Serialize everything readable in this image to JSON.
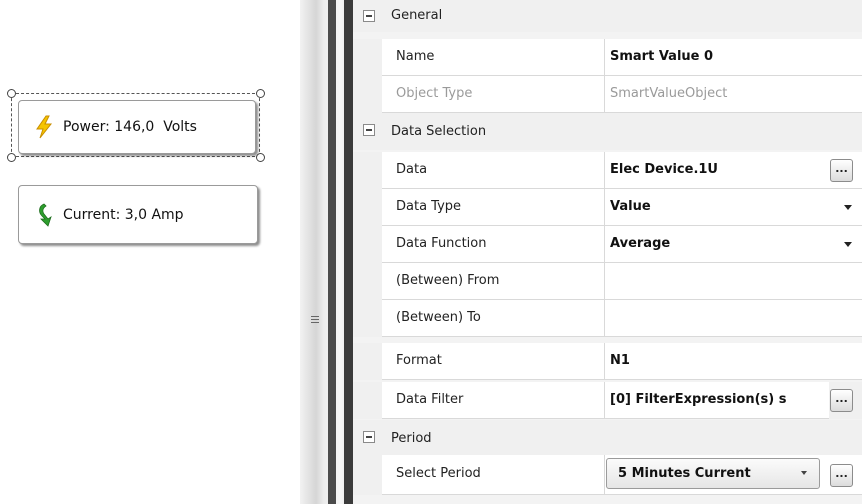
{
  "canvas": {
    "widgets": [
      {
        "label": "Power: 146,0  Volts",
        "icon": "lightning-icon"
      },
      {
        "label": "Current: 3,0 Amp",
        "icon": "current-arrow-icon"
      }
    ]
  },
  "property_grid": {
    "categories": {
      "general": {
        "label": "General"
      },
      "data_selection": {
        "label": "Data Selection"
      },
      "period": {
        "label": "Period"
      }
    },
    "props": {
      "name": {
        "label": "Name",
        "value": "Smart Value 0"
      },
      "object_type": {
        "label": "Object Type",
        "value": "SmartValueObject"
      },
      "data": {
        "label": "Data",
        "value": "Elec Device.1U",
        "button": "..."
      },
      "data_type": {
        "label": "Data Type",
        "value": "Value"
      },
      "data_function": {
        "label": "Data Function",
        "value": "Average"
      },
      "between_from": {
        "label": "(Between) From",
        "value": ""
      },
      "between_to": {
        "label": "(Between) To",
        "value": ""
      },
      "format": {
        "label": "Format",
        "value": "N1"
      },
      "data_filter": {
        "label": "Data Filter",
        "value": "[0] FilterExpression(s) s",
        "button": "..."
      },
      "select_period": {
        "label": "Select Period",
        "value": "5 Minutes Current",
        "button": "..."
      }
    }
  },
  "colors": {
    "lightning": "#f5c400",
    "current_arrow": "#2e9e2e",
    "splitter_dark": "#3b3b3b"
  }
}
